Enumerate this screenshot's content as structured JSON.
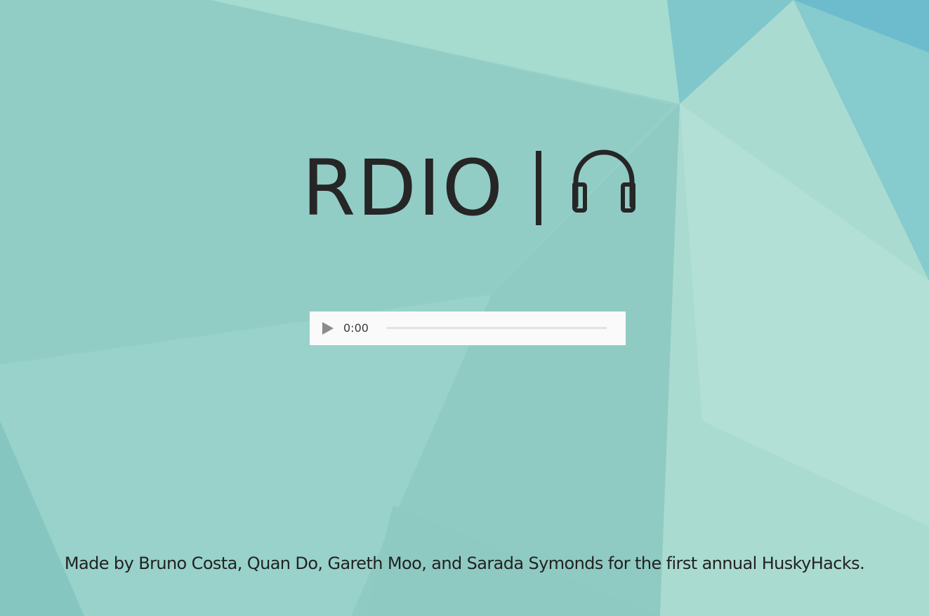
{
  "header": {
    "title": "RDIO",
    "separator": "|",
    "icon": "headphones-icon"
  },
  "player": {
    "play_icon": "play-icon",
    "current_time": "0:00",
    "progress": 0
  },
  "footer": {
    "credits": "Made by Bruno Costa, Quan Do, Gareth Moo, and Sarada Symonds for the first annual HuskyHacks."
  },
  "colors": {
    "background": "#94cfc7",
    "text": "#262626",
    "player_bg": "#fafafa"
  }
}
